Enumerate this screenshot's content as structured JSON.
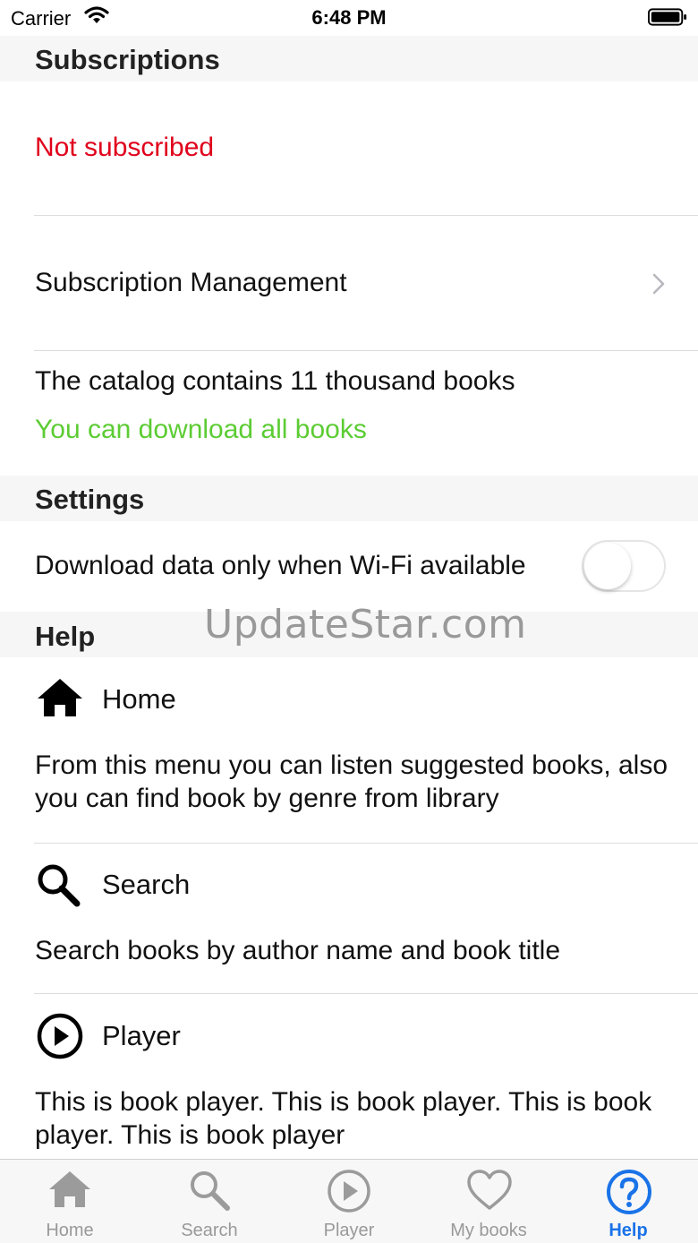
{
  "status_bar": {
    "carrier": "Carrier",
    "time": "6:48 PM"
  },
  "subscriptions": {
    "header": "Subscriptions",
    "status": "Not subscribed",
    "status_color": "#e0001b",
    "management": "Subscription Management",
    "catalog": "The catalog contains 11 thousand books",
    "download_all": "You can download all books",
    "download_all_color": "#5ccc33"
  },
  "settings": {
    "header": "Settings",
    "wifi_only": {
      "label": "Download data only when Wi-Fi available",
      "on": false
    }
  },
  "watermark": "UpdateStar.com",
  "help": {
    "header": "Help",
    "items": [
      {
        "icon": "home-icon",
        "title": "Home",
        "desc": "From this menu you can listen suggested books, also you can find book by genre from library"
      },
      {
        "icon": "search-icon",
        "title": "Search",
        "desc": "Search books by author name and book title"
      },
      {
        "icon": "play-circle-icon",
        "title": "Player",
        "desc": "This is book player. This is book player. This is book player. This is book player"
      }
    ]
  },
  "tabs": [
    {
      "label": "Home",
      "icon": "home-icon",
      "active": false
    },
    {
      "label": "Search",
      "icon": "search-icon",
      "active": false
    },
    {
      "label": "Player",
      "icon": "play-circle-icon",
      "active": false
    },
    {
      "label": "My books",
      "icon": "heart-icon",
      "active": false
    },
    {
      "label": "Help",
      "icon": "question-circle-icon",
      "active": true
    }
  ],
  "colors": {
    "accent": "#1a73e8",
    "inactive_tab": "#999999"
  }
}
